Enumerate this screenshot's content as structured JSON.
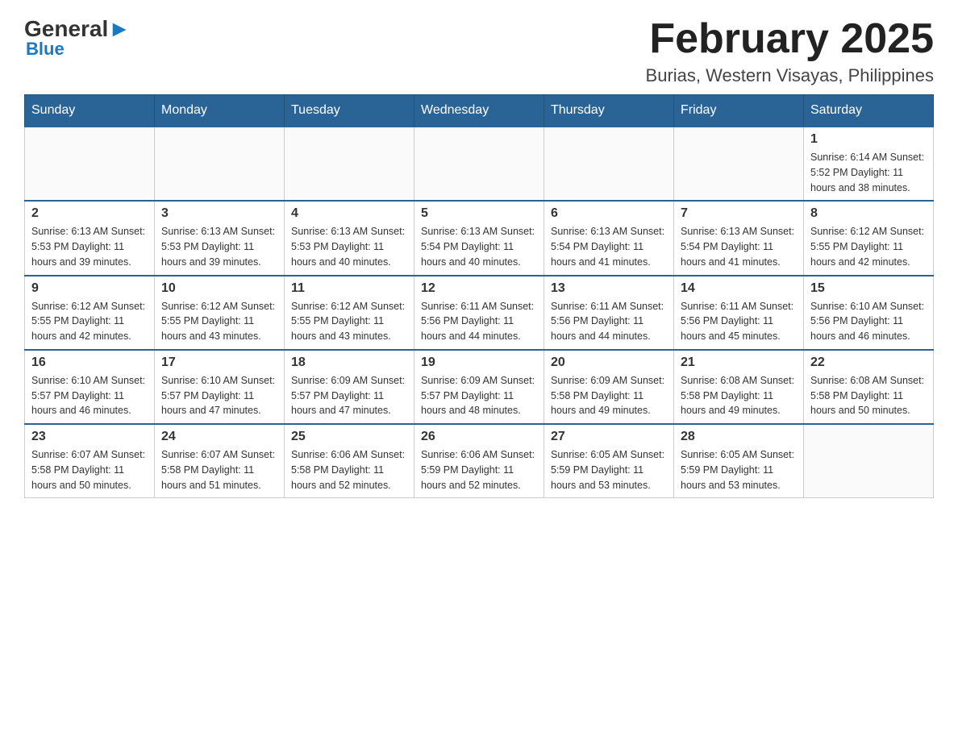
{
  "logo": {
    "text_general": "General",
    "text_blue": "Blue"
  },
  "title": "February 2025",
  "subtitle": "Burias, Western Visayas, Philippines",
  "weekdays": [
    "Sunday",
    "Monday",
    "Tuesday",
    "Wednesday",
    "Thursday",
    "Friday",
    "Saturday"
  ],
  "weeks": [
    [
      {
        "day": "",
        "info": ""
      },
      {
        "day": "",
        "info": ""
      },
      {
        "day": "",
        "info": ""
      },
      {
        "day": "",
        "info": ""
      },
      {
        "day": "",
        "info": ""
      },
      {
        "day": "",
        "info": ""
      },
      {
        "day": "1",
        "info": "Sunrise: 6:14 AM\nSunset: 5:52 PM\nDaylight: 11 hours and 38 minutes."
      }
    ],
    [
      {
        "day": "2",
        "info": "Sunrise: 6:13 AM\nSunset: 5:53 PM\nDaylight: 11 hours and 39 minutes."
      },
      {
        "day": "3",
        "info": "Sunrise: 6:13 AM\nSunset: 5:53 PM\nDaylight: 11 hours and 39 minutes."
      },
      {
        "day": "4",
        "info": "Sunrise: 6:13 AM\nSunset: 5:53 PM\nDaylight: 11 hours and 40 minutes."
      },
      {
        "day": "5",
        "info": "Sunrise: 6:13 AM\nSunset: 5:54 PM\nDaylight: 11 hours and 40 minutes."
      },
      {
        "day": "6",
        "info": "Sunrise: 6:13 AM\nSunset: 5:54 PM\nDaylight: 11 hours and 41 minutes."
      },
      {
        "day": "7",
        "info": "Sunrise: 6:13 AM\nSunset: 5:54 PM\nDaylight: 11 hours and 41 minutes."
      },
      {
        "day": "8",
        "info": "Sunrise: 6:12 AM\nSunset: 5:55 PM\nDaylight: 11 hours and 42 minutes."
      }
    ],
    [
      {
        "day": "9",
        "info": "Sunrise: 6:12 AM\nSunset: 5:55 PM\nDaylight: 11 hours and 42 minutes."
      },
      {
        "day": "10",
        "info": "Sunrise: 6:12 AM\nSunset: 5:55 PM\nDaylight: 11 hours and 43 minutes."
      },
      {
        "day": "11",
        "info": "Sunrise: 6:12 AM\nSunset: 5:55 PM\nDaylight: 11 hours and 43 minutes."
      },
      {
        "day": "12",
        "info": "Sunrise: 6:11 AM\nSunset: 5:56 PM\nDaylight: 11 hours and 44 minutes."
      },
      {
        "day": "13",
        "info": "Sunrise: 6:11 AM\nSunset: 5:56 PM\nDaylight: 11 hours and 44 minutes."
      },
      {
        "day": "14",
        "info": "Sunrise: 6:11 AM\nSunset: 5:56 PM\nDaylight: 11 hours and 45 minutes."
      },
      {
        "day": "15",
        "info": "Sunrise: 6:10 AM\nSunset: 5:56 PM\nDaylight: 11 hours and 46 minutes."
      }
    ],
    [
      {
        "day": "16",
        "info": "Sunrise: 6:10 AM\nSunset: 5:57 PM\nDaylight: 11 hours and 46 minutes."
      },
      {
        "day": "17",
        "info": "Sunrise: 6:10 AM\nSunset: 5:57 PM\nDaylight: 11 hours and 47 minutes."
      },
      {
        "day": "18",
        "info": "Sunrise: 6:09 AM\nSunset: 5:57 PM\nDaylight: 11 hours and 47 minutes."
      },
      {
        "day": "19",
        "info": "Sunrise: 6:09 AM\nSunset: 5:57 PM\nDaylight: 11 hours and 48 minutes."
      },
      {
        "day": "20",
        "info": "Sunrise: 6:09 AM\nSunset: 5:58 PM\nDaylight: 11 hours and 49 minutes."
      },
      {
        "day": "21",
        "info": "Sunrise: 6:08 AM\nSunset: 5:58 PM\nDaylight: 11 hours and 49 minutes."
      },
      {
        "day": "22",
        "info": "Sunrise: 6:08 AM\nSunset: 5:58 PM\nDaylight: 11 hours and 50 minutes."
      }
    ],
    [
      {
        "day": "23",
        "info": "Sunrise: 6:07 AM\nSunset: 5:58 PM\nDaylight: 11 hours and 50 minutes."
      },
      {
        "day": "24",
        "info": "Sunrise: 6:07 AM\nSunset: 5:58 PM\nDaylight: 11 hours and 51 minutes."
      },
      {
        "day": "25",
        "info": "Sunrise: 6:06 AM\nSunset: 5:58 PM\nDaylight: 11 hours and 52 minutes."
      },
      {
        "day": "26",
        "info": "Sunrise: 6:06 AM\nSunset: 5:59 PM\nDaylight: 11 hours and 52 minutes."
      },
      {
        "day": "27",
        "info": "Sunrise: 6:05 AM\nSunset: 5:59 PM\nDaylight: 11 hours and 53 minutes."
      },
      {
        "day": "28",
        "info": "Sunrise: 6:05 AM\nSunset: 5:59 PM\nDaylight: 11 hours and 53 minutes."
      },
      {
        "day": "",
        "info": ""
      }
    ]
  ]
}
